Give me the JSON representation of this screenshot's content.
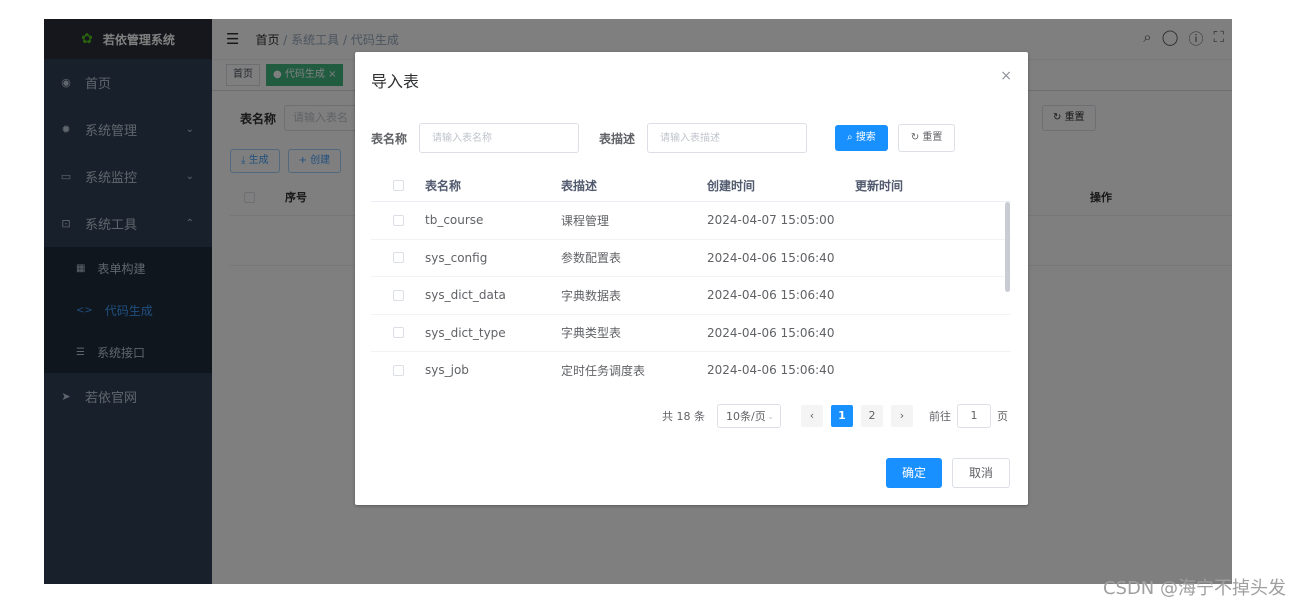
{
  "sidebar": {
    "logo": "若依管理系统",
    "items": [
      {
        "label": "首页",
        "icon": "dashboard-icon"
      },
      {
        "label": "系统管理",
        "icon": "gear-icon"
      },
      {
        "label": "系统监控",
        "icon": "monitor-icon"
      },
      {
        "label": "系统工具",
        "icon": "toolbox-icon"
      }
    ],
    "sub_items": [
      {
        "label": "表单构建"
      },
      {
        "label": "代码生成"
      },
      {
        "label": "系统接口"
      }
    ],
    "last_item": {
      "label": "若依官网"
    }
  },
  "navbar": {
    "breadcrumb": [
      "首页",
      "系统工具",
      "代码生成"
    ]
  },
  "tags": [
    "首页",
    "● 代码生成 ×"
  ],
  "background": {
    "form_label": "表名称",
    "form_placeholder": "请输入表名",
    "reset": "重置",
    "gen": "生成",
    "create": "创建",
    "col_index": "序号",
    "col_ops": "操作"
  },
  "dialog": {
    "title": "导入表",
    "close": "×",
    "table_name_label": "表名称",
    "table_name_placeholder": "请输入表名称",
    "table_desc_label": "表描述",
    "table_desc_placeholder": "请输入表描述",
    "search_btn": "搜索",
    "reset_btn": "重置",
    "columns": [
      "表名称",
      "表描述",
      "创建时间",
      "更新时间"
    ],
    "rows": [
      {
        "name": "tb_course",
        "desc": "课程管理",
        "created": "2024-04-07 15:05:00",
        "updated": ""
      },
      {
        "name": "sys_config",
        "desc": "参数配置表",
        "created": "2024-04-06 15:06:40",
        "updated": ""
      },
      {
        "name": "sys_dict_data",
        "desc": "字典数据表",
        "created": "2024-04-06 15:06:40",
        "updated": ""
      },
      {
        "name": "sys_dict_type",
        "desc": "字典类型表",
        "created": "2024-04-06 15:06:40",
        "updated": ""
      },
      {
        "name": "sys_job",
        "desc": "定时任务调度表",
        "created": "2024-04-06 15:06:40",
        "updated": ""
      }
    ],
    "pagination": {
      "total": "共 18 条",
      "page_size": "10条/页",
      "pages": [
        "1",
        "2"
      ],
      "current": "1",
      "goto_label": "前往",
      "goto_value": "1",
      "goto_suffix": "页"
    },
    "ok": "确定",
    "cancel": "取消"
  },
  "watermark": "CSDN @海宁不掉头发"
}
